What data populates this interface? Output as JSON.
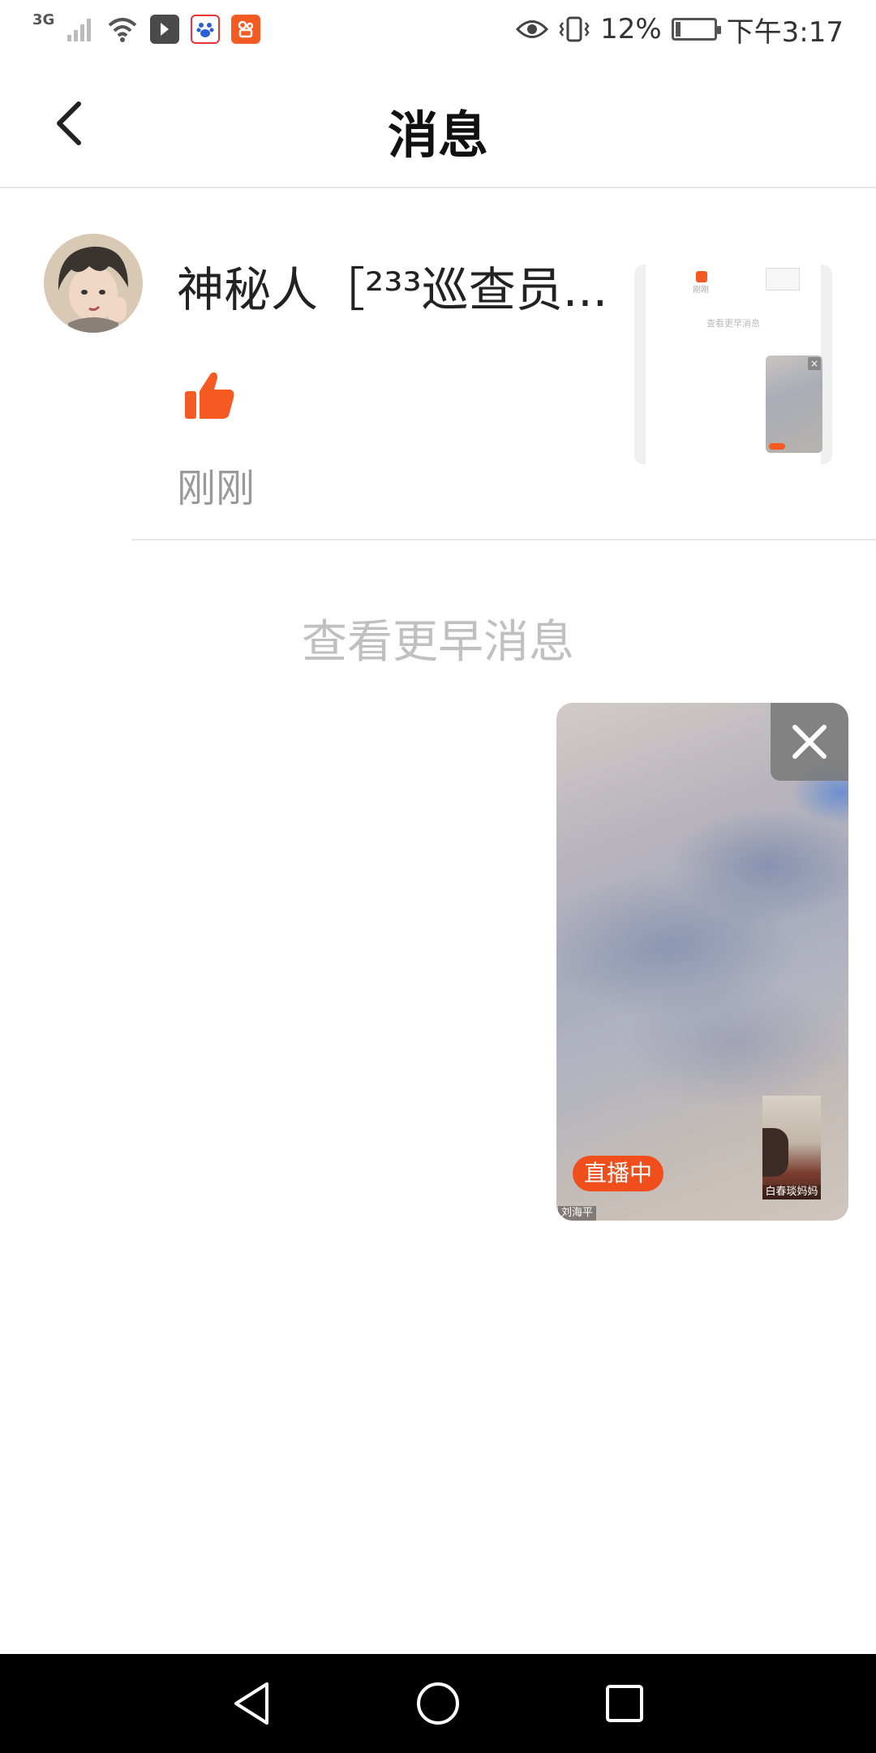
{
  "status_bar": {
    "network": "3G",
    "battery_percent": "12%",
    "battery_level": 0.12,
    "time": "下午3:17"
  },
  "header": {
    "title": "消息"
  },
  "message": {
    "sender_name": "神秘人［²³³巡查员...",
    "time": "刚刚",
    "thumbnail": {
      "time": "刚刚",
      "more": "查看更早消息"
    }
  },
  "view_earlier": "查看更早消息",
  "floating_live": {
    "live_label": "直播中",
    "host_name": "刘海平",
    "guest_name": "白春琰妈妈"
  },
  "colors": {
    "accent": "#f45a22",
    "live_badge": "#f04f1c",
    "muted_text": "#9a9a9a",
    "hint_text": "#c0c0c0"
  }
}
